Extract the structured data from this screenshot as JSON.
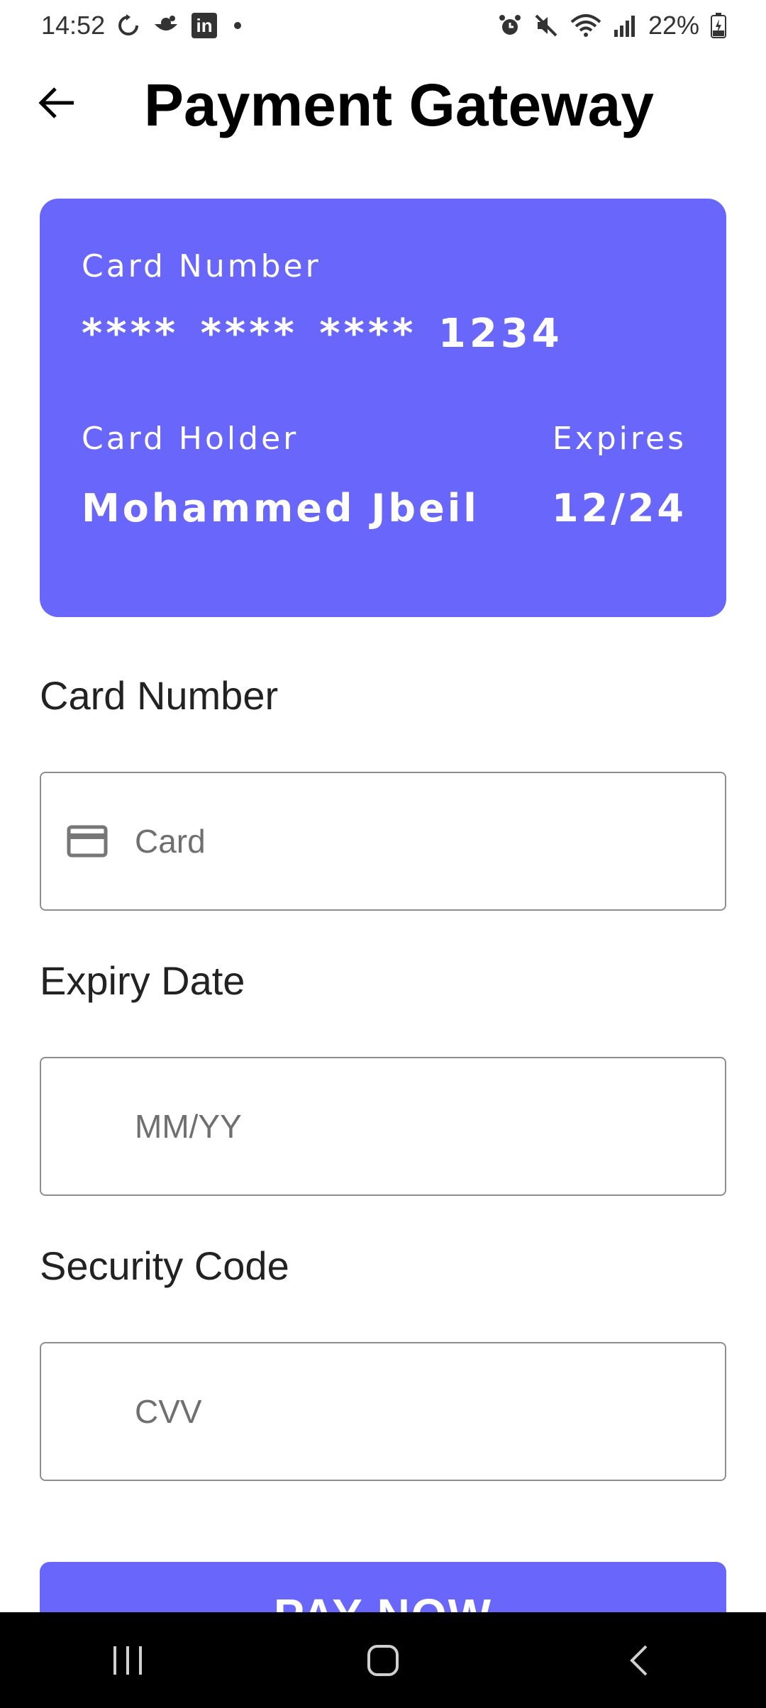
{
  "status_bar": {
    "time": "14:52",
    "battery": "22%",
    "icons_left": [
      "sync-icon",
      "cloud-icon",
      "linkedin-icon",
      "dot-icon"
    ],
    "icons_right": [
      "alarm-icon",
      "mute-icon",
      "wifi-icon",
      "signal-icon",
      "battery-icon"
    ]
  },
  "header": {
    "title": "Payment Gateway",
    "back_icon": "arrow-left-icon"
  },
  "card_preview": {
    "number_label": "Card Number",
    "number": "**** **** **** 1234",
    "holder_label": "Card Holder",
    "holder": "Mohammed Jbeil",
    "expires_label": "Expires",
    "expiry": "12/24",
    "background_color": "#6966fc"
  },
  "form": {
    "card_number": {
      "label": "Card Number",
      "placeholder": "Card",
      "value": "",
      "icon": "credit-card-icon"
    },
    "expiry_date": {
      "label": "Expiry Date",
      "placeholder": "MM/YY",
      "value": ""
    },
    "security_code": {
      "label": "Security Code",
      "placeholder": "CVV",
      "value": ""
    }
  },
  "pay_button": {
    "label": "PAY NOW"
  },
  "nav_bar": {
    "items": [
      "recents-icon",
      "home-icon",
      "back-icon"
    ]
  },
  "colors": {
    "accent": "#6966fc",
    "nav_background": "#000000"
  }
}
